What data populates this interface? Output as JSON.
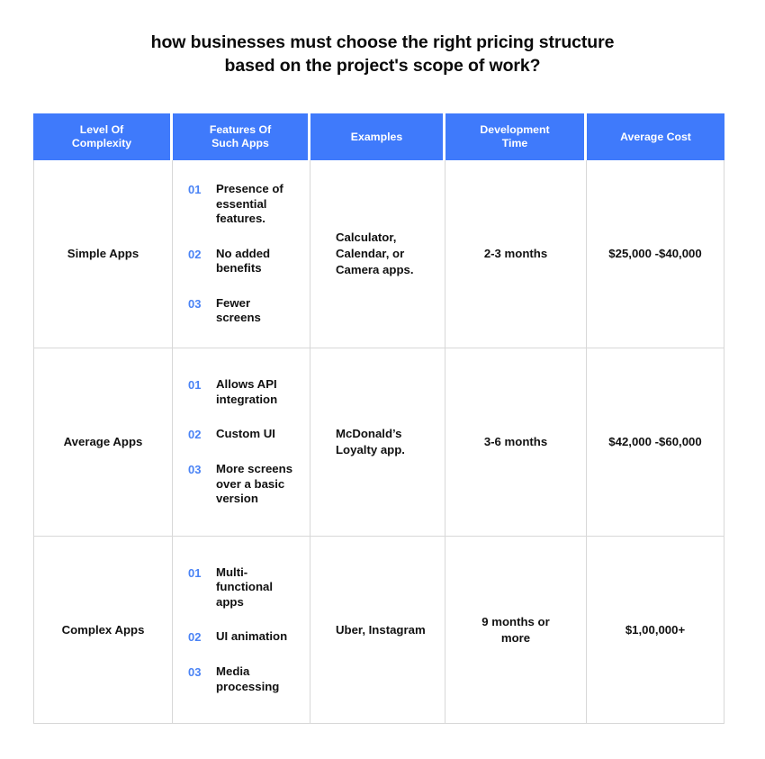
{
  "title": {
    "line1": "how businesses must choose the right pricing structure",
    "line2": "based on the project's scope of work?"
  },
  "colors": {
    "header_blue": "#3f7afb",
    "number_blue": "#4a83f5",
    "border_gray": "#d8d8d8",
    "text_black": "#111111",
    "background": "#ffffff"
  },
  "table": {
    "headers": [
      {
        "line1": "Level Of",
        "line2": "Complexity"
      },
      {
        "line1": "Features Of",
        "line2": "Such Apps"
      },
      {
        "line1": "Examples",
        "line2": ""
      },
      {
        "line1": "Development",
        "line2": "Time"
      },
      {
        "line1": "Average Cost",
        "line2": ""
      }
    ],
    "rows": [
      {
        "complexity": "Simple Apps",
        "features": [
          {
            "num": "01",
            "line1": "Presence of",
            "line2": "essential",
            "line3": "features."
          },
          {
            "num": "02",
            "line1": "No added",
            "line2": "benefits",
            "line3": ""
          },
          {
            "num": "03",
            "line1": "Fewer",
            "line2": "screens",
            "line3": ""
          }
        ],
        "examples": {
          "line1": "Calculator,",
          "line2": "Calendar, or",
          "line3": "Camera apps."
        },
        "time": {
          "line1": "2-3 months",
          "line2": ""
        },
        "cost": "$25,000 -$40,000"
      },
      {
        "complexity": "Average Apps",
        "features": [
          {
            "num": "01",
            "line1": "Allows API",
            "line2": "integration",
            "line3": ""
          },
          {
            "num": "02",
            "line1": "Custom UI",
            "line2": "",
            "line3": ""
          },
          {
            "num": "03",
            "line1": "More screens",
            "line2": "over a basic",
            "line3": "version"
          }
        ],
        "examples": {
          "line1": "McDonald’s",
          "line2": "Loyalty app.",
          "line3": ""
        },
        "time": {
          "line1": "3-6 months",
          "line2": ""
        },
        "cost": "$42,000 -$60,000"
      },
      {
        "complexity": "Complex Apps",
        "features": [
          {
            "num": "01",
            "line1": "Multi-",
            "line2": "functional",
            "line3": "apps"
          },
          {
            "num": "02",
            "line1": "UI animation",
            "line2": "",
            "line3": ""
          },
          {
            "num": "03",
            "line1": "Media",
            "line2": "processing",
            "line3": ""
          }
        ],
        "examples": {
          "line1": "Uber, Instagram",
          "line2": "",
          "line3": ""
        },
        "time": {
          "line1": "9 months or",
          "line2": "more"
        },
        "cost": "$1,00,000+"
      }
    ]
  }
}
